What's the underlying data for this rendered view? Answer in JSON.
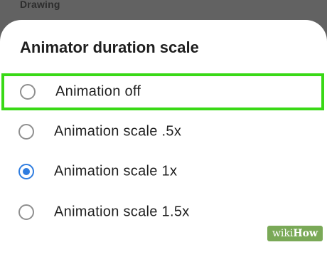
{
  "background": {
    "label": "Drawing"
  },
  "dialog": {
    "title": "Animator duration scale",
    "options": [
      {
        "label": "Animation off",
        "selected": false,
        "highlighted": true
      },
      {
        "label": "Animation scale .5x",
        "selected": false,
        "highlighted": false
      },
      {
        "label": "Animation scale 1x",
        "selected": true,
        "highlighted": false
      },
      {
        "label": "Animation scale 1.5x",
        "selected": false,
        "highlighted": false
      }
    ]
  },
  "watermark": {
    "part1": "wiki",
    "part2": "How"
  },
  "colors": {
    "highlight": "#39d916",
    "radio_checked": "#2f7de0",
    "backdrop": "#626262"
  }
}
